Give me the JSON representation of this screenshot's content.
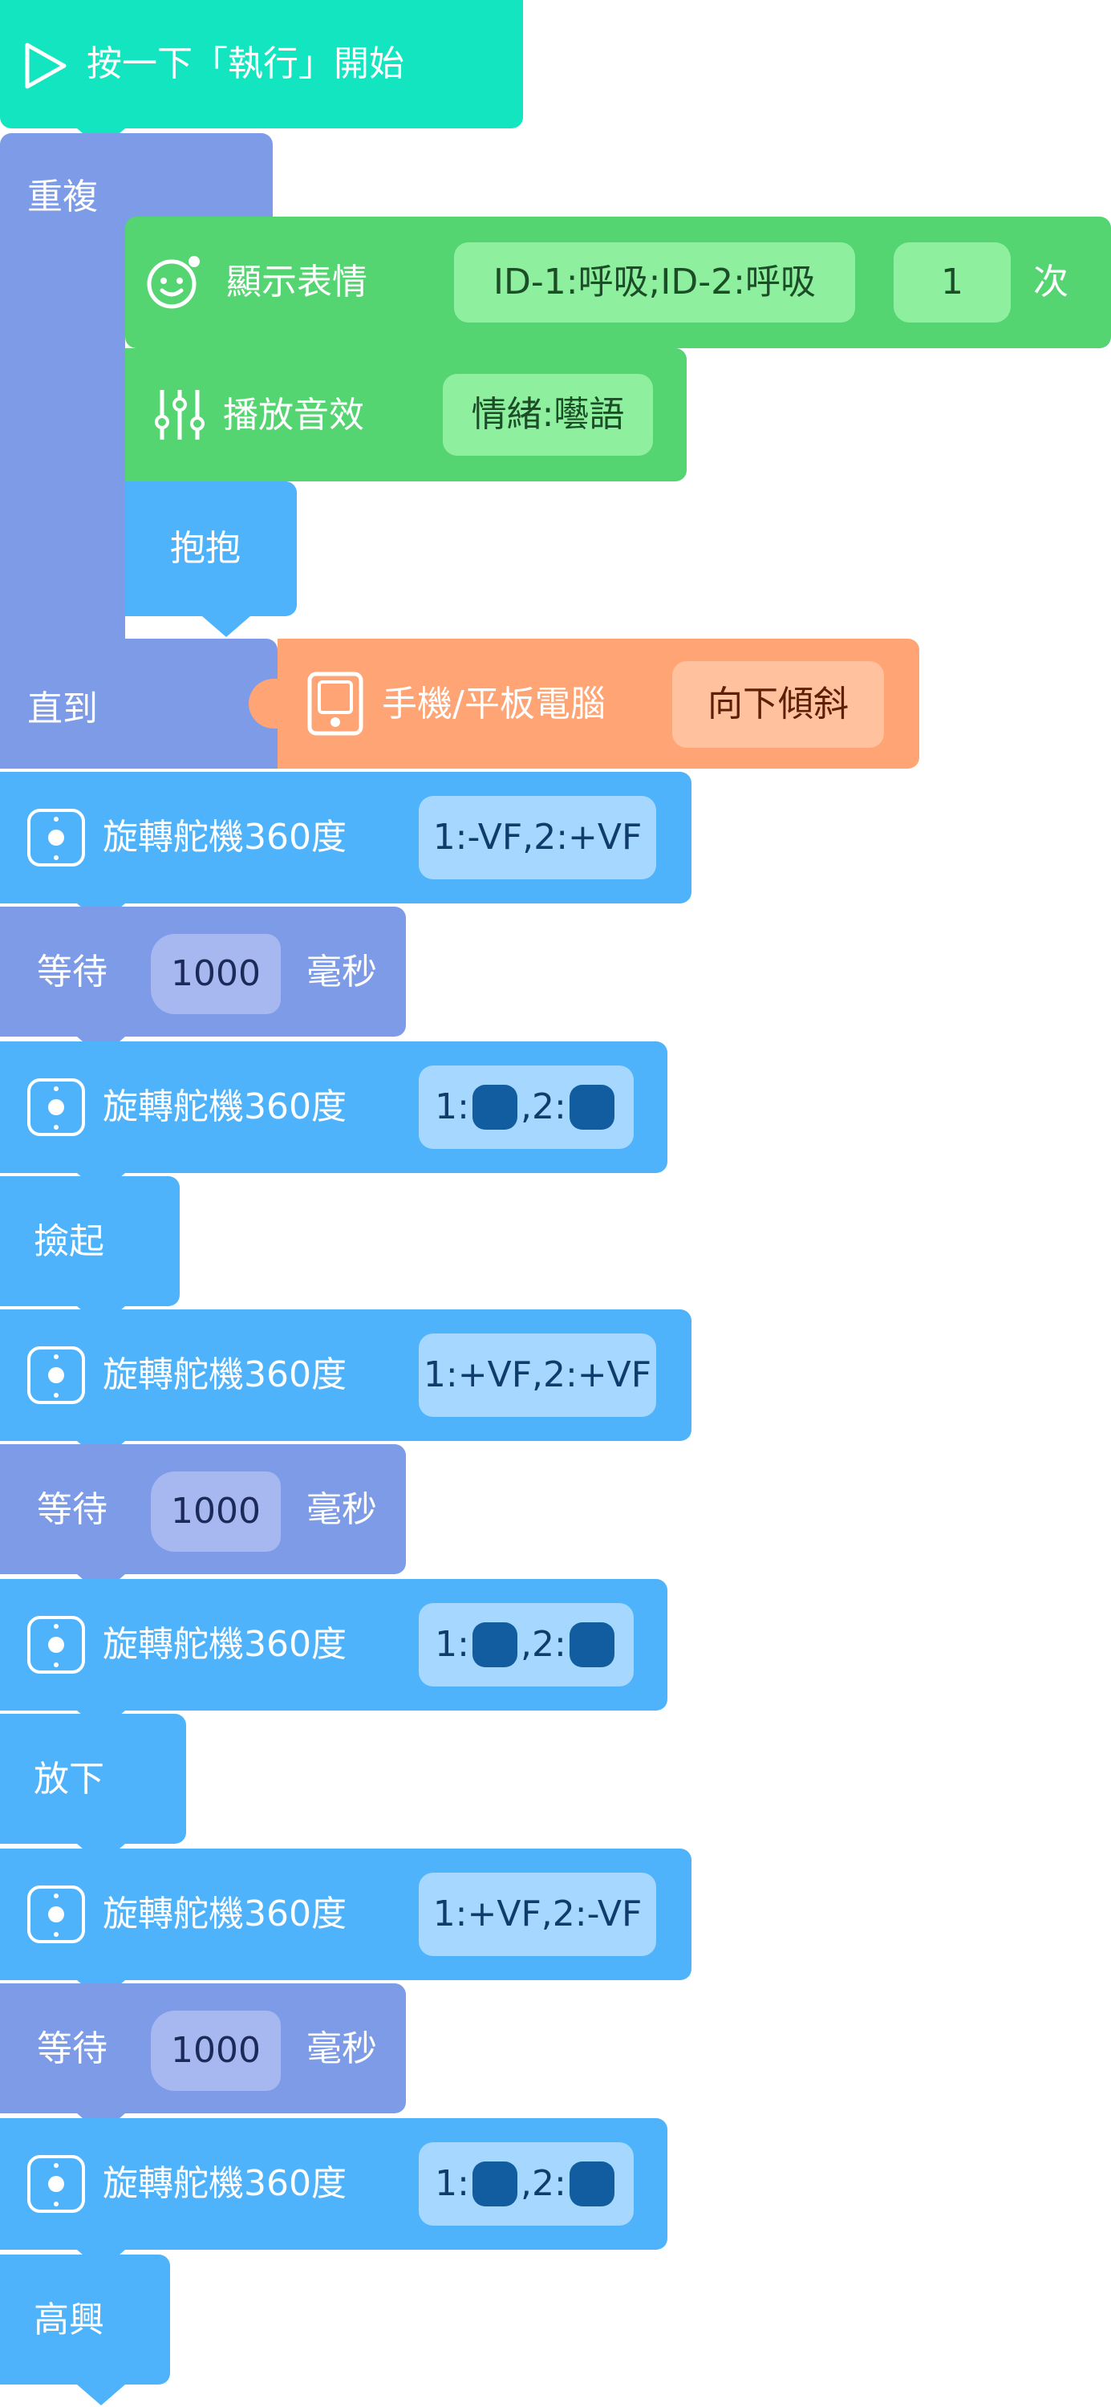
{
  "start": {
    "label": "按一下「執行」開始"
  },
  "loop": {
    "repeat_label": "重複",
    "until_label": "直到",
    "inner": {
      "show_expression": {
        "label": "顯示表情",
        "value": "ID-1:呼吸;ID-2:呼吸",
        "count": "1",
        "count_unit": "次"
      },
      "play_sound": {
        "label": "播放音效",
        "value": "情緒:囈語"
      },
      "hug": {
        "label": "抱抱"
      }
    },
    "condition": {
      "label": "手機/平板電腦",
      "value": "向下傾斜"
    }
  },
  "blocks": [
    {
      "kind": "servo",
      "label": "旋轉舵機360度",
      "value": "1:-VF,2:+VF"
    },
    {
      "kind": "wait",
      "label": "等待",
      "value": "1000",
      "unit": "毫秒"
    },
    {
      "kind": "servo_color",
      "label": "旋轉舵機360度",
      "prefix1": "1:",
      "prefix2": ",2:"
    },
    {
      "kind": "action",
      "label": "撿起"
    },
    {
      "kind": "servo",
      "label": "旋轉舵機360度",
      "value": "1:+VF,2:+VF"
    },
    {
      "kind": "wait",
      "label": "等待",
      "value": "1000",
      "unit": "毫秒"
    },
    {
      "kind": "servo_color",
      "label": "旋轉舵機360度",
      "prefix1": "1:",
      "prefix2": ",2:"
    },
    {
      "kind": "action",
      "label": "放下"
    },
    {
      "kind": "servo",
      "label": "旋轉舵機360度",
      "value": "1:+VF,2:-VF"
    },
    {
      "kind": "wait",
      "label": "等待",
      "value": "1000",
      "unit": "毫秒"
    },
    {
      "kind": "servo_color",
      "label": "旋轉舵機360度",
      "prefix1": "1:",
      "prefix2": ",2:"
    },
    {
      "kind": "action",
      "label": "高興"
    }
  ],
  "colors": {
    "start": "#12e5bf",
    "control": "#7d9be6",
    "display": "#55d472",
    "motion": "#4fb3fb",
    "sensor": "#ffa474",
    "servo_swatch": "#115da0"
  },
  "icons": {
    "start": "play-triangle-icon",
    "expression": "smiley-face-icon",
    "sound": "equalizer-sliders-icon",
    "tablet": "tablet-icon",
    "servo": "servo-dial-icon"
  }
}
